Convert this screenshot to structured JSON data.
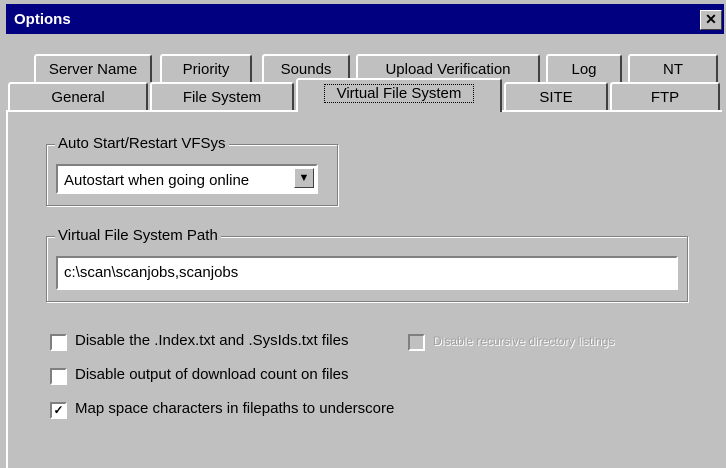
{
  "window": {
    "title": "Options",
    "close_glyph": "✕"
  },
  "tabs": {
    "row_back": [
      {
        "label": "Server Name"
      },
      {
        "label": "Priority"
      },
      {
        "label": "Sounds"
      },
      {
        "label": "Upload Verification"
      },
      {
        "label": "Log"
      },
      {
        "label": "NT"
      }
    ],
    "row_front": [
      {
        "label": "General"
      },
      {
        "label": "File System"
      },
      {
        "label": "Virtual File System",
        "active": true
      },
      {
        "label": "SITE"
      },
      {
        "label": "FTP"
      }
    ]
  },
  "auto_start": {
    "group_label": "Auto Start/Restart VFSys",
    "selected": "Autostart when going online",
    "dropdown_glyph": "▼"
  },
  "vfs_path": {
    "group_label": "Virtual File System Path",
    "value": "c:\\scan\\scanjobs,scanjobs"
  },
  "options": {
    "disable_index": {
      "label": "Disable the .Index.txt and .SysIds.txt files",
      "checked": false
    },
    "disable_recursive": {
      "label": "Disable recursive directory listings",
      "checked": false,
      "enabled": false
    },
    "disable_download_count": {
      "label": "Disable output of download count on files",
      "checked": false
    },
    "map_spaces": {
      "label": "Map space characters in filepaths to underscore",
      "checked": true,
      "check_glyph": "✓"
    }
  }
}
